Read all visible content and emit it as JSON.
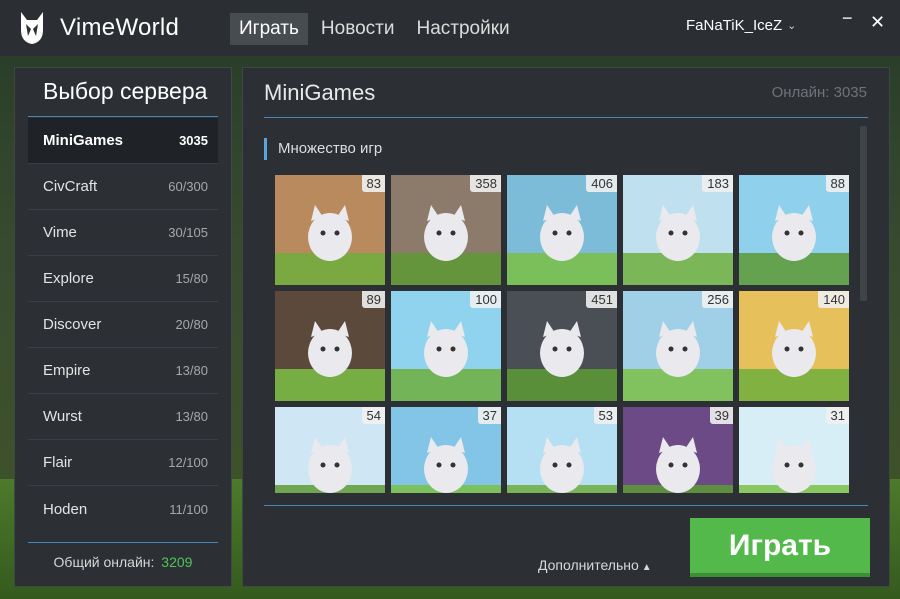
{
  "app": {
    "title": "VimeWorld"
  },
  "nav": [
    {
      "label": "Играть"
    },
    {
      "label": "Новости"
    },
    {
      "label": "Настройки"
    }
  ],
  "user": {
    "name": "FaNaTiK_IceZ"
  },
  "window": {
    "minimize": "−",
    "close": "✕"
  },
  "sidebar": {
    "title": "Выбор сервера",
    "servers": [
      {
        "name": "MiniGames",
        "count": "3035"
      },
      {
        "name": "CivCraft",
        "count": "60/300"
      },
      {
        "name": "Vime",
        "count": "30/105"
      },
      {
        "name": "Explore",
        "count": "15/80"
      },
      {
        "name": "Discover",
        "count": "20/80"
      },
      {
        "name": "Empire",
        "count": "13/80"
      },
      {
        "name": "Wurst",
        "count": "13/80"
      },
      {
        "name": "Flair",
        "count": "12/100"
      },
      {
        "name": "Hoden",
        "count": "11/100"
      }
    ],
    "total_label": "Общий онлайн:",
    "total_value": "3209"
  },
  "main": {
    "title": "MiniGames",
    "online": "Онлайн: 3035",
    "section": "Множество игр",
    "games": [
      {
        "count": "83",
        "color": "#b98a5e"
      },
      {
        "count": "358",
        "color": "#8c7b6b"
      },
      {
        "count": "406",
        "color": "#7cbcd8"
      },
      {
        "count": "183",
        "color": "#bfe0ee"
      },
      {
        "count": "88",
        "color": "#8fd0ec"
      },
      {
        "count": "89",
        "color": "#5b4a3c"
      },
      {
        "count": "100",
        "color": "#8fd3ef"
      },
      {
        "count": "451",
        "color": "#4a4f55"
      },
      {
        "count": "256",
        "color": "#9fd0e8"
      },
      {
        "count": "140",
        "color": "#e6c05a"
      },
      {
        "count": "54",
        "color": "#cfe6f4"
      },
      {
        "count": "37",
        "color": "#82c5e6"
      },
      {
        "count": "53",
        "color": "#b5dff2"
      },
      {
        "count": "39",
        "color": "#6c4a86"
      },
      {
        "count": "31",
        "color": "#d8eef7"
      }
    ],
    "more_label": "Дополнительно",
    "play_label": "Играть"
  }
}
